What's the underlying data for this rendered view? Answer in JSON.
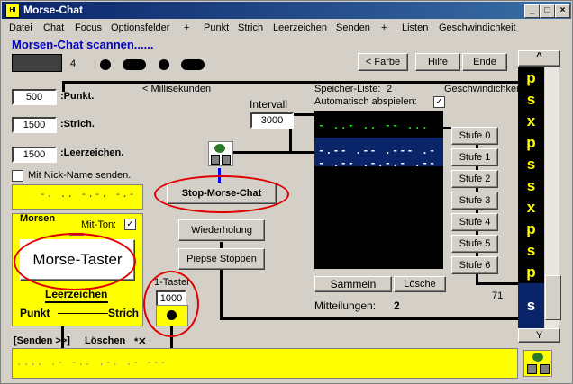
{
  "window": {
    "title": "Morse-Chat",
    "icon_text": "HI",
    "min": "_",
    "max": "□",
    "close": "×"
  },
  "menu": [
    "Datei",
    "Chat",
    "Focus",
    "Optionsfelder",
    "+",
    "Punkt",
    "Strich",
    "Leerzeichen",
    "Senden",
    "+",
    "Listen",
    "Geschwindichkeit"
  ],
  "status_title": "Morsen-Chat scannen......",
  "counter": "4",
  "buttons": {
    "farbe": "< Farbe",
    "hilfe": "Hilfe",
    "ende": "Ende",
    "up": "^",
    "down": "Y",
    "stop": "Stop-Morse-Chat",
    "wiederholung": "Wiederholung",
    "piepse": "Piepse Stoppen",
    "sammeln": "Sammeln",
    "loesche": "Lösche",
    "taster": "Morse-Taster"
  },
  "timing": {
    "punkt_value": "500",
    "punkt_label": ":Punkt.",
    "strich_value": "1500",
    "strich_label": ":Strich.",
    "leer_value": "1500",
    "leer_label": ":Leerzeichen.",
    "ms_label": "< Millisekunden"
  },
  "nick": {
    "label": "Mit Nick-Name senden.",
    "checked": false
  },
  "nick_morse": "-. .. -.-. -.-",
  "morsen": {
    "group_label": "Morsen",
    "mit_ton_label": "Mit-Ton:",
    "mit_ton_checked": "✓",
    "leerzeichen": "Leerzeichen",
    "punkt": "Punkt",
    "strich": "Strich"
  },
  "intervall": {
    "label": "Intervall",
    "value": "3000"
  },
  "taster1": {
    "label": "1-Taster",
    "value": "1000"
  },
  "speicher": {
    "label": "Speicher-Liste:",
    "count": "2",
    "auto_label": "Automatisch abspielen:",
    "auto_checked": "✓",
    "rows": [
      "- ..- .. -- ... .. .. . .",
      "-.-- .-- .--- .-- .-- .-.-.- .--"
    ]
  },
  "geschw_label": "Geschwindichkeit",
  "stufen": [
    "Stufe 0",
    "Stufe 1",
    "Stufe 2",
    "Stufe 3",
    "Stufe 4",
    "Stufe 5",
    "Stufe 6"
  ],
  "mitteilungen": {
    "label": "Mitteilungen:",
    "value": "2"
  },
  "scroll_count": "71",
  "sidebar_letters": [
    "p",
    "s",
    "x",
    "p",
    "s",
    "s",
    "x",
    "p",
    "s",
    "p",
    "s"
  ],
  "senden_label": "[Senden >>]",
  "loeschen_label": "Löschen",
  "loeschen_icon": "*✕",
  "bottom_morse": ".... .- -.. .-. .- ---",
  "colors": {
    "accent": "#0000c0",
    "highlight": "#ffff00",
    "alert": "#e00000",
    "listtext": "#00ff00"
  }
}
